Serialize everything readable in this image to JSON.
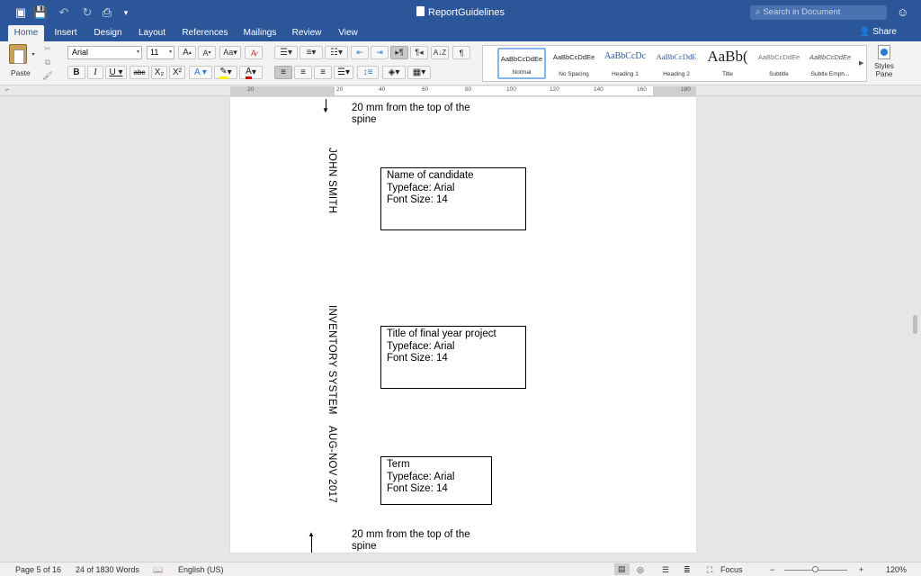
{
  "window": {
    "title": "ReportGuidelines",
    "search_placeholder": "Search in Document"
  },
  "ribbon_tabs": [
    "Home",
    "Insert",
    "Design",
    "Layout",
    "References",
    "Mailings",
    "Review",
    "View"
  ],
  "active_tab": "Home",
  "share_label": "Share",
  "clipboard": {
    "paste_label": "Paste"
  },
  "font": {
    "name": "Arial",
    "size": "11"
  },
  "styles": [
    {
      "sample": "AaBbCcDdEe",
      "name": "Normal"
    },
    {
      "sample": "AaBbCcDdEe",
      "name": "No Spacing"
    },
    {
      "sample": "AaBbCcDc",
      "name": "Heading 1"
    },
    {
      "sample": "AaBbCcDdE",
      "name": "Heading 2"
    },
    {
      "sample": "AaBb(",
      "name": "Title"
    },
    {
      "sample": "AaBbCcDdEe",
      "name": "Subtitle"
    },
    {
      "sample": "AaBbCcDdEe",
      "name": "Subtle Emph..."
    }
  ],
  "styles_pane_label": "Styles Pane",
  "ruler": {
    "labels": [
      "20",
      "20",
      "40",
      "60",
      "80",
      "100",
      "120",
      "140",
      "160",
      "180"
    ]
  },
  "document": {
    "top_note": "20 mm from the top of the spine",
    "bottom_note": "20 mm from the top of the spine",
    "spine_name": "JOHN SMITH",
    "spine_project": "INVENTORY SYSTEM",
    "spine_term": "AUG-NOV 2017",
    "boxes": [
      {
        "title": "Name of candidate",
        "typeface": "Typeface: Arial",
        "size": "Font Size: 14"
      },
      {
        "title": "Title of final year project",
        "typeface": "Typeface: Arial",
        "size": "Font Size: 14"
      },
      {
        "title": "Term",
        "typeface": "Typeface: Arial",
        "size": "Font Size: 14"
      }
    ]
  },
  "status": {
    "page": "Page 5 of 16",
    "words": "24 of 1830 Words",
    "language": "English (US)",
    "focus": "Focus",
    "zoom": "120%"
  }
}
